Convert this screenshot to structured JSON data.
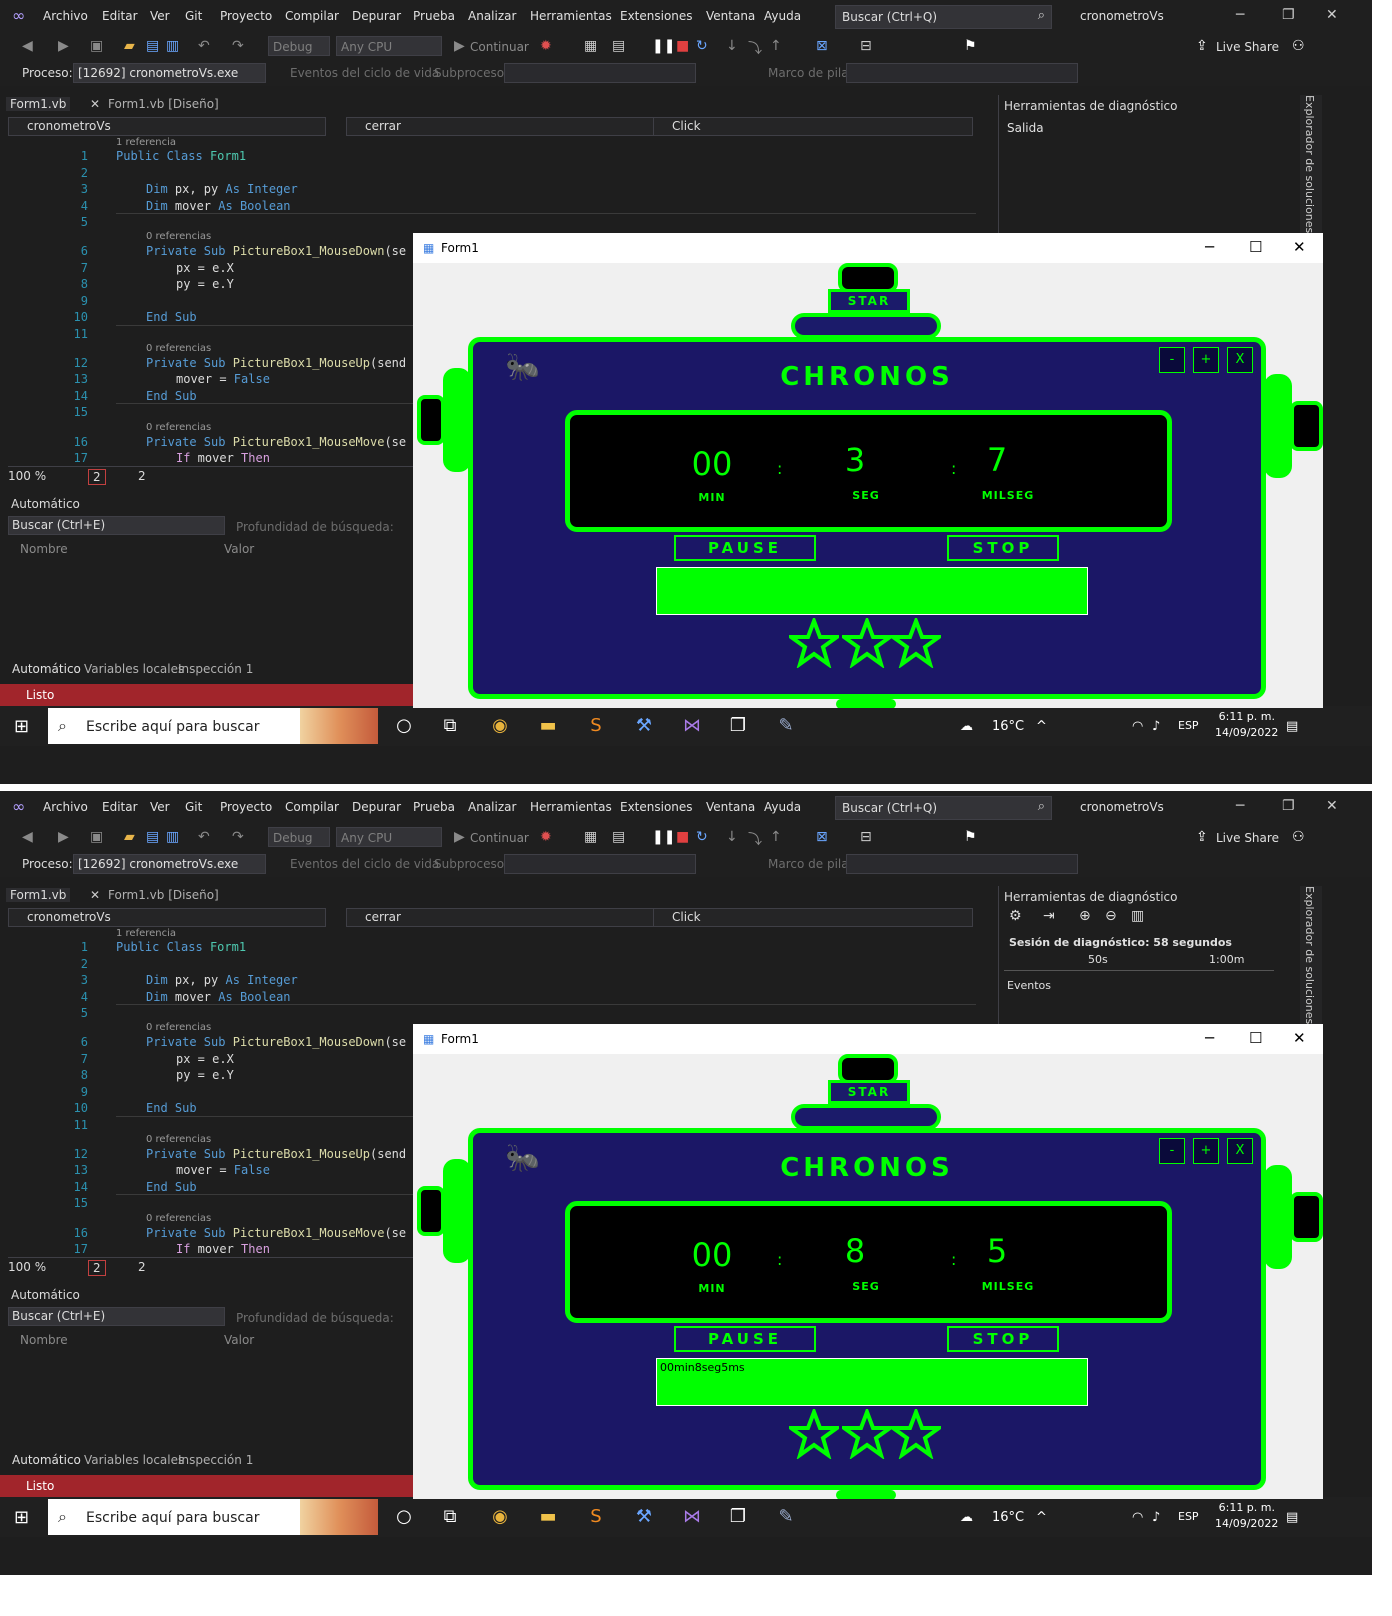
{
  "menu": {
    "items": [
      "Archivo",
      "Editar",
      "Ver",
      "Git",
      "Proyecto",
      "Compilar",
      "Depurar",
      "Prueba",
      "Analizar",
      "Herramientas",
      "Extensiones",
      "Ventana",
      "Ayuda"
    ],
    "search_placeholder": "Buscar (Ctrl+Q)",
    "project_name": "cronometroVs"
  },
  "toolbar": {
    "config": "Debug",
    "platform": "Any CPU",
    "continue_label": "Continuar",
    "live_share": "Live Share"
  },
  "process_bar": {
    "label": "Proceso:",
    "process": "[12692] cronometroVs.exe",
    "lifecycle": "Eventos del ciclo de vida",
    "thread": "Subproceso:",
    "stack": "Marco de pila:"
  },
  "editor": {
    "tabs": [
      "Form1.vb",
      "Form1.vb [Diseño]"
    ],
    "nav_project": "cronometroVs",
    "nav_member": "cerrar",
    "nav_event": "Click",
    "refs": [
      "1 referencia",
      "0 referencias",
      "0 referencias",
      "0 referencias"
    ],
    "line_numbers": [
      "1",
      "2",
      "3",
      "4",
      "5",
      "6",
      "7",
      "8",
      "9",
      "10",
      "11",
      "12",
      "13",
      "14",
      "15",
      "16",
      "17"
    ],
    "zoom": "100 %",
    "errors": "2",
    "warnings": "2"
  },
  "autos": {
    "title": "Automático",
    "search": "Buscar (Ctrl+E)",
    "depth": "Profundidad de búsqueda:",
    "col_name": "Nombre",
    "col_value": "Valor",
    "tabs": [
      "Automático",
      "Variables locales",
      "Inspección 1"
    ]
  },
  "status": "Listo",
  "diagnostics": {
    "title": "Herramientas de diagnóstico",
    "output_item": "Salida",
    "session": "Sesión de diagnóstico: 58 segundos",
    "ticks": [
      "50s",
      "1:00m"
    ],
    "events": "Eventos",
    "side_panel": "Explorador de soluciones"
  },
  "taskbar": {
    "search": "Escribe aquí para buscar",
    "temperature": "16°C",
    "lang": "ESP",
    "time": "6:11 p. m.",
    "date": "14/09/2022",
    "notifications": "6"
  },
  "form": {
    "title": "Form1",
    "brand": "CHRONOS",
    "star_label": "STAR",
    "pause_label": "PAUSE",
    "stop_label": "STOP",
    "min_unit": "MIN",
    "seg_unit": "SEG",
    "ms_unit": "MILSEG",
    "window_btns": [
      "-",
      "+",
      "X"
    ]
  },
  "shots": [
    {
      "min": "00",
      "sec": "3",
      "ms": "7",
      "result": ""
    },
    {
      "min": "00",
      "sec": "8",
      "ms": "5",
      "result": "00min8seg5ms"
    }
  ],
  "colors": {
    "neon": "#00ff00",
    "panel": "#1b1766",
    "vs_dark": "#1e1e1e",
    "status_red": "#a1252b"
  }
}
